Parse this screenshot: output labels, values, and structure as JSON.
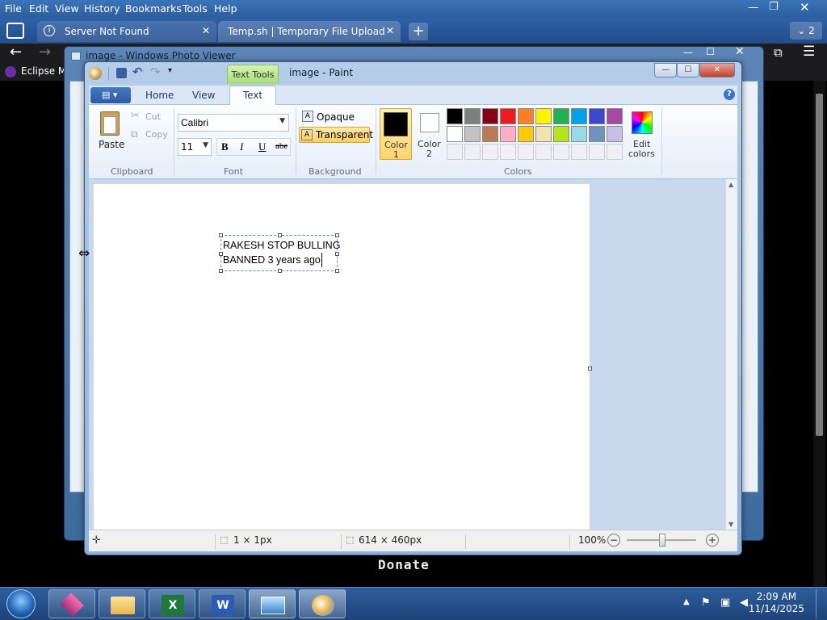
{
  "firefox": {
    "menu": [
      "File",
      "Edit",
      "View",
      "History",
      "Bookmarks",
      "Tools",
      "Help"
    ],
    "tabs": [
      {
        "label": "Server Not Found"
      },
      {
        "label": "Temp.sh | Temporary File Upload"
      }
    ],
    "tab_count": "2",
    "bookmark": "Eclipse M",
    "page_text": "Donate"
  },
  "photo_viewer": {
    "title": "image - Windows Photo Viewer"
  },
  "paint": {
    "contextual_tab": "Text Tools",
    "title": "image - Paint",
    "tabs": [
      "Home",
      "View",
      "Text"
    ],
    "clipboard": {
      "paste": "Paste",
      "cut": "Cut",
      "copy": "Copy",
      "label": "Clipboard"
    },
    "font": {
      "family": "Calibri",
      "size": "11",
      "bold": "B",
      "italic": "I",
      "underline": "U",
      "strike": "abe",
      "label": "Font"
    },
    "background": {
      "opaque": "Opaque",
      "transparent": "Transparent",
      "label": "Background"
    },
    "colors": {
      "color1": "Color 1",
      "color1_line1": "Color",
      "color1_line2": "1",
      "color2_line1": "Color",
      "color2_line2": "2",
      "edit_line1": "Edit",
      "edit_line2": "colors",
      "label": "Colors",
      "palette_row1": [
        "#000000",
        "#7f7f7f",
        "#880015",
        "#ed1c24",
        "#ff7f27",
        "#fff200",
        "#22b14c",
        "#00a2e8",
        "#3f48cc",
        "#a349a4"
      ],
      "palette_row2": [
        "#ffffff",
        "#c3c3c3",
        "#b97a57",
        "#ffaec9",
        "#ffc90e",
        "#efe4b0",
        "#b5e61d",
        "#99d9ea",
        "#7092be",
        "#c8bfe7"
      ]
    },
    "text_box": {
      "line1": "RAKESH STOP BULLING",
      "line2": "BANNED 3 years ago"
    },
    "status": {
      "selection": "1 × 1px",
      "size": "614 × 460px",
      "zoom": "100%"
    }
  },
  "taskbar": {
    "time": "2:09 AM",
    "date": "11/14/2025"
  }
}
